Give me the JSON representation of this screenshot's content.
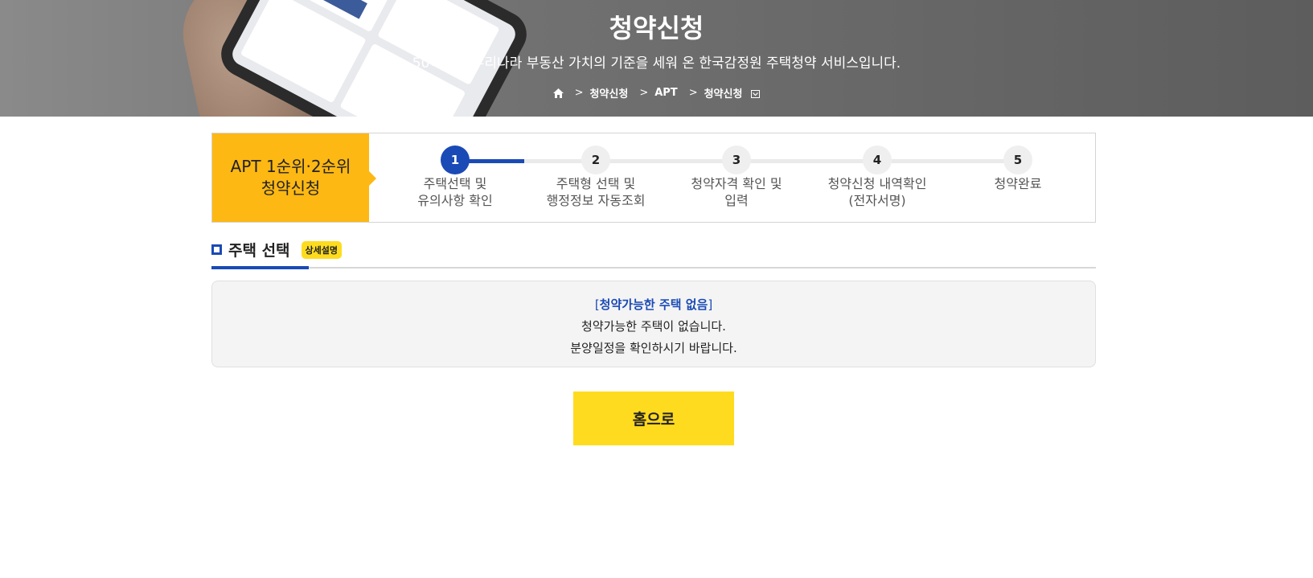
{
  "hero": {
    "title": "청약신청",
    "subtitle": "50여년간 우리나라 부동산 가치의 기준을 세워 온 한국감정원 주택청약 서비스입니다.",
    "breadcrumb": [
      "청약신청",
      "APT",
      "청약신청"
    ]
  },
  "steps": {
    "label_line1": "APT 1순위·2순위",
    "label_line2": "청약신청",
    "current": 1,
    "items": [
      {
        "num": "1",
        "line1": "주택선택 및",
        "line2": "유의사항 확인"
      },
      {
        "num": "2",
        "line1": "주택형 선택 및",
        "line2": "행정정보 자동조회"
      },
      {
        "num": "3",
        "line1": "청약자격 확인 및",
        "line2": "입력"
      },
      {
        "num": "4",
        "line1": "청약신청 내역확인",
        "line2": "(전자서명)"
      },
      {
        "num": "5",
        "line1": "청약완료",
        "line2": ""
      }
    ]
  },
  "section": {
    "title": "주택 선택",
    "badge": "상세설명"
  },
  "notice": {
    "title": "청약가능한 주택 없음",
    "line1": "청약가능한 주택이 없습니다.",
    "line2": "분양일정을 확인하시기 바랍니다."
  },
  "button": {
    "home": "홈으로"
  },
  "colors": {
    "accent_blue": "#1a4ab5",
    "step_yellow": "#fdb813",
    "button_yellow": "#ffdb1f"
  }
}
